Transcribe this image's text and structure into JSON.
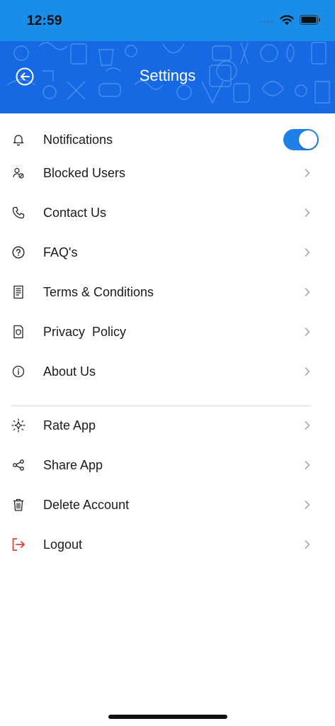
{
  "status_bar": {
    "time": "12:59"
  },
  "header": {
    "title": "Settings",
    "background_color": "#1669e2",
    "back_icon": "back-arrow-circle-icon"
  },
  "settings": {
    "items": [
      {
        "label": "Notifications",
        "icon": "bell-icon",
        "type": "toggle",
        "enabled": true
      },
      {
        "label": "Blocked Users",
        "icon": "blocked-users-icon",
        "type": "link"
      },
      {
        "label": "Contact Us",
        "icon": "phone-icon",
        "type": "link"
      },
      {
        "label": "FAQ's",
        "icon": "question-circle-icon",
        "type": "link"
      },
      {
        "label": "Terms & Conditions",
        "icon": "document-icon",
        "type": "link"
      },
      {
        "label": "Privacy  Policy",
        "icon": "shield-document-icon",
        "type": "link"
      },
      {
        "label": "About Us",
        "icon": "info-circle-icon",
        "type": "link"
      }
    ],
    "secondary_items": [
      {
        "label": "Rate App",
        "icon": "sparkle-icon",
        "type": "link"
      },
      {
        "label": "Share App",
        "icon": "share-icon",
        "type": "link"
      },
      {
        "label": "Delete Account",
        "icon": "trash-icon",
        "type": "link"
      },
      {
        "label": "Logout",
        "icon": "logout-icon",
        "type": "link",
        "icon_color": "#e53935"
      }
    ]
  },
  "colors": {
    "accent": "#2180e8",
    "divider": "#d8d8d8"
  }
}
